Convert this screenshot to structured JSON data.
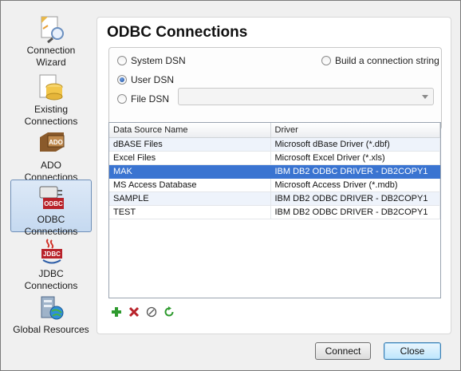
{
  "nav": {
    "items": [
      {
        "label": "Connection Wizard",
        "line1": "Connection",
        "line2": "Wizard",
        "icon": "wand-icon"
      },
      {
        "label": "Existing Connections",
        "line1": "Existing",
        "line2": "Connections",
        "icon": "database-icon"
      },
      {
        "label": "ADO Connections",
        "line1": "ADO",
        "line2": "Connections",
        "icon": "ado-icon"
      },
      {
        "label": "ODBC Connections",
        "line1": "ODBC",
        "line2": "Connections",
        "icon": "odbc-plug-icon"
      },
      {
        "label": "JDBC Connections",
        "line1": "JDBC",
        "line2": "Connections",
        "icon": "jdbc-icon"
      },
      {
        "label": "Global Resources",
        "line1": "Global Resources",
        "line2": "",
        "icon": "global-resources-icon"
      }
    ],
    "selected": "ODBC Connections"
  },
  "main": {
    "title": "ODBC Connections",
    "dsn": {
      "system": "System DSN",
      "user": "User DSN",
      "file": "File DSN",
      "build": "Build a connection string",
      "selected": "User DSN"
    },
    "table": {
      "columns": [
        "Data Source Name",
        "Driver"
      ],
      "rows": [
        {
          "name": "dBASE Files",
          "driver": "Microsoft dBase Driver (*.dbf)"
        },
        {
          "name": "Excel Files",
          "driver": "Microsoft Excel Driver (*.xls)"
        },
        {
          "name": "MAK",
          "driver": "IBM DB2 ODBC DRIVER - DB2COPY1"
        },
        {
          "name": "MS Access Database",
          "driver": "Microsoft Access Driver (*.mdb)"
        },
        {
          "name": "SAMPLE",
          "driver": "IBM DB2 ODBC DRIVER - DB2COPY1"
        },
        {
          "name": "TEST",
          "driver": "IBM DB2 ODBC DRIVER - DB2COPY1"
        }
      ],
      "selected_row": "MAK"
    },
    "toolbar": [
      "add-icon",
      "delete-icon",
      "edit-icon",
      "refresh-icon"
    ]
  },
  "buttons": {
    "connect": "Connect",
    "close": "Close"
  },
  "colors": {
    "selection": "#3a74d1",
    "accent_green": "#2e9a2e",
    "delete_red": "#b8222a"
  }
}
